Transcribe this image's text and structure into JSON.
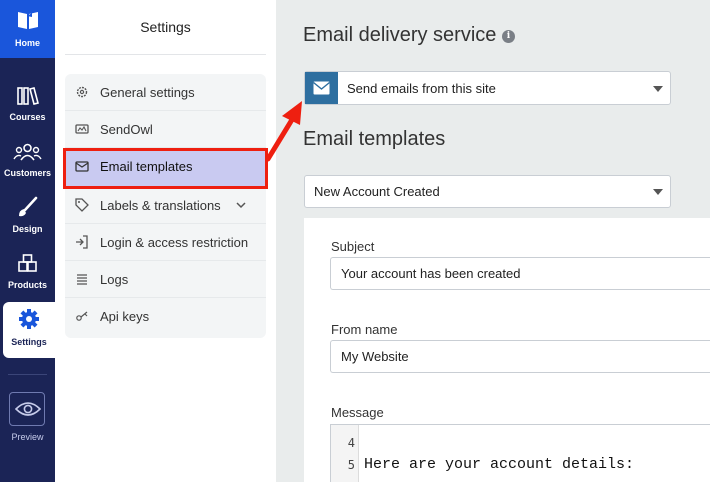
{
  "rail": {
    "home": "Home",
    "courses": "Courses",
    "customers": "Customers",
    "design": "Design",
    "products": "Products",
    "settings": "Settings",
    "preview": "Preview"
  },
  "settings_panel": {
    "title": "Settings",
    "items": [
      {
        "label": "General settings",
        "icon": "gear-icon"
      },
      {
        "label": "SendOwl",
        "icon": "sendowl-icon"
      },
      {
        "label": "Email templates",
        "icon": "envelope-icon"
      },
      {
        "label": "Labels & translations",
        "icon": "tag-icon"
      },
      {
        "label": "Login & access restriction",
        "icon": "login-icon"
      },
      {
        "label": "Logs",
        "icon": "list-icon"
      },
      {
        "label": "Api keys",
        "icon": "key-icon"
      }
    ],
    "selected": "Email templates"
  },
  "main": {
    "delivery_title": "Email delivery service",
    "info_glyph": "i",
    "delivery_value": "Send emails from this site",
    "templates_title": "Email templates",
    "template_value": "New Account Created",
    "subject_label": "Subject",
    "subject_value": "Your account has been created",
    "from_label": "From name",
    "from_value": "My Website",
    "message_label": "Message",
    "editor": {
      "line_numbers": [
        "4",
        "5"
      ],
      "line_5": "Here are your account details:"
    }
  },
  "colors": {
    "rail_bg": "#1b2456",
    "home_bg": "#1a56db",
    "selected_bg": "#c9caf1",
    "annotation_red": "#ee1f10",
    "mail_badge": "#2e6fa0"
  }
}
